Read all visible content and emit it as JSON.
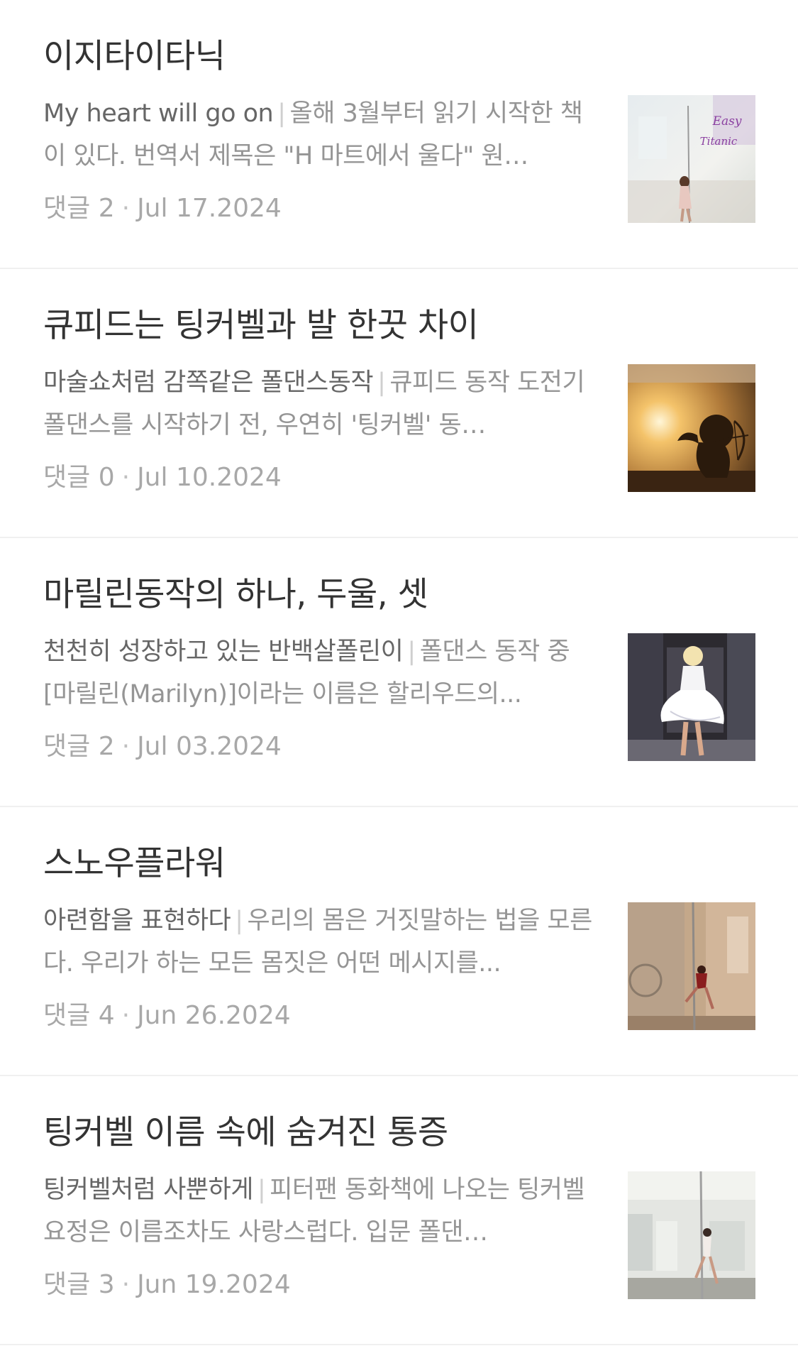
{
  "posts": [
    {
      "title": "이지타이타닉",
      "subtitle": "My heart will go on",
      "excerpt": "올해 3월부터 읽기 시작한 책이 있다.  번역서 제목은 \"H 마트에서 울다\" 원…",
      "comment_label": "댓글",
      "comment_count": "2",
      "date": "Jul 17.2024",
      "thumb_text_1": "Easy",
      "thumb_text_2": "Titanic"
    },
    {
      "title": "큐피드는 팅커벨과 발 한끗 차이",
      "subtitle": "마술쇼처럼 감쪽같은 폴댄스동작",
      "excerpt": "큐피드 동작 도전기  폴댄스를 시작하기 전, 우연히 '팅커벨' 동…",
      "comment_label": "댓글",
      "comment_count": "0",
      "date": "Jul 10.2024"
    },
    {
      "title": "마릴린동작의 하나, 두울, 셋",
      "subtitle": "천천히 성장하고 있는 반백살폴린이",
      "excerpt": "폴댄스 동작 중 [마릴린(Marilyn)]이라는 이름은  할리우드의...",
      "comment_label": "댓글",
      "comment_count": "2",
      "date": "Jul 03.2024"
    },
    {
      "title": "스노우플라워",
      "subtitle": "아련함을 표현하다",
      "excerpt": "우리의 몸은 거짓말하는 법을 모른다.  우리가 하는 모든 몸짓은 어떤 메시지를...",
      "comment_label": "댓글",
      "comment_count": "4",
      "date": "Jun 26.2024"
    },
    {
      "title": "팅커벨 이름 속에 숨겨진 통증",
      "subtitle": "팅커벨처럼  사뿐하게",
      "excerpt": "피터팬 동화책에 나오는 팅커벨 요정은 이름조차도 사랑스럽다. 입문 폴댄…",
      "comment_label": "댓글",
      "comment_count": "3",
      "date": "Jun 19.2024"
    }
  ],
  "colors": {
    "title": "#333333",
    "subtitle": "#666666",
    "excerpt": "#959595",
    "meta": "#a8a8a8",
    "divider": "#f0f0f0"
  }
}
